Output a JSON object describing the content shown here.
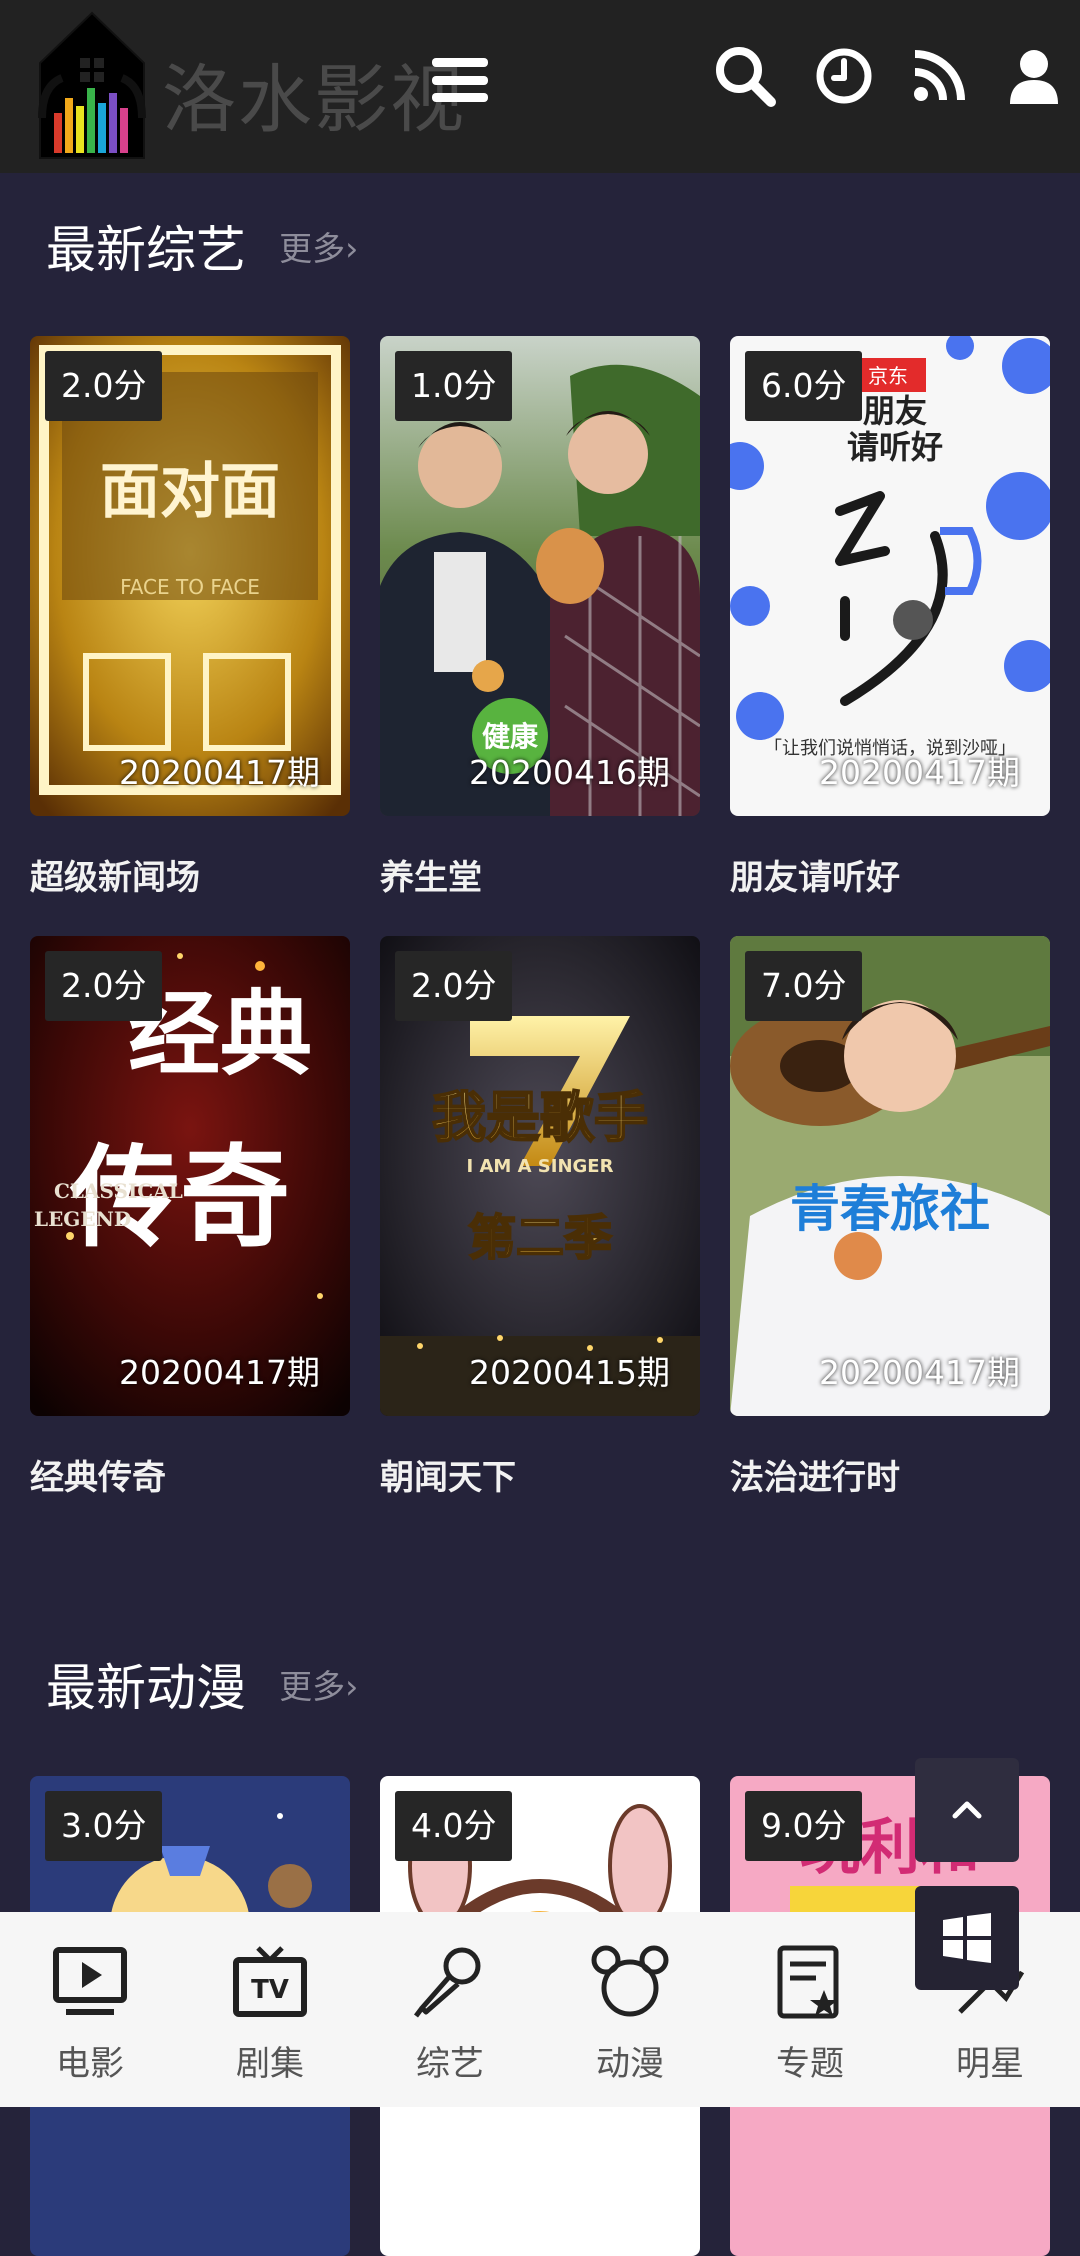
{
  "header": {
    "site_name": "洛水影视",
    "icons": [
      "logo-house-equalizer",
      "menu-icon",
      "search-icon",
      "history-clock-icon",
      "rss-icon",
      "user-icon"
    ]
  },
  "sections": [
    {
      "title": "最新综艺",
      "more": "更多›",
      "items": [
        {
          "score": "2.0分",
          "episode": "20200417期",
          "title": "超级新闻场"
        },
        {
          "score": "1.0分",
          "episode": "20200416期",
          "title": "养生堂"
        },
        {
          "score": "6.0分",
          "episode": "20200417期",
          "title": "朋友请听好"
        },
        {
          "score": "2.0分",
          "episode": "20200417期",
          "title": "经典传奇"
        },
        {
          "score": "2.0分",
          "episode": "20200415期",
          "title": "朝闻天下"
        },
        {
          "score": "7.0分",
          "episode": "20200417期",
          "title": "法治进行时"
        }
      ]
    },
    {
      "title": "最新动漫",
      "more": "更多›",
      "items": [
        {
          "score": "3.0分"
        },
        {
          "score": "4.0分"
        },
        {
          "score": "9.0分"
        }
      ]
    }
  ],
  "posters": {
    "p1": {
      "main": "面对面",
      "sub": "FACE TO FACE"
    },
    "p2": {
      "badge": "健康"
    },
    "p3": {
      "brand": "京东",
      "line1": "朋友",
      "line2": "请听好",
      "quote": "「让我们说悄悄话，说到沙哑」"
    },
    "p4": {
      "main1": "经典",
      "main2": "传奇",
      "sub1": "CLASSICAL",
      "sub2": "LEGEND"
    },
    "p5": {
      "main": "我是歌手",
      "sub": "I AM A SINGER",
      "season": "第二季"
    },
    "p6": {
      "main": "青春旅社"
    },
    "p9": {
      "main": "玩利和"
    }
  },
  "bottom_nav": [
    {
      "label": "电影",
      "icon": "movie-screen-icon"
    },
    {
      "label": "剧集",
      "icon": "tv-icon"
    },
    {
      "label": "综艺",
      "icon": "microphone-icon"
    },
    {
      "label": "动漫",
      "icon": "mickey-icon"
    },
    {
      "label": "专题",
      "icon": "topic-star-icon"
    },
    {
      "label": "明星",
      "icon": "star-person-icon"
    }
  ],
  "colors": {
    "background": "#25233a",
    "header": "#222222",
    "nav_bg": "#f6f6f6",
    "score_bg": "#262626"
  }
}
